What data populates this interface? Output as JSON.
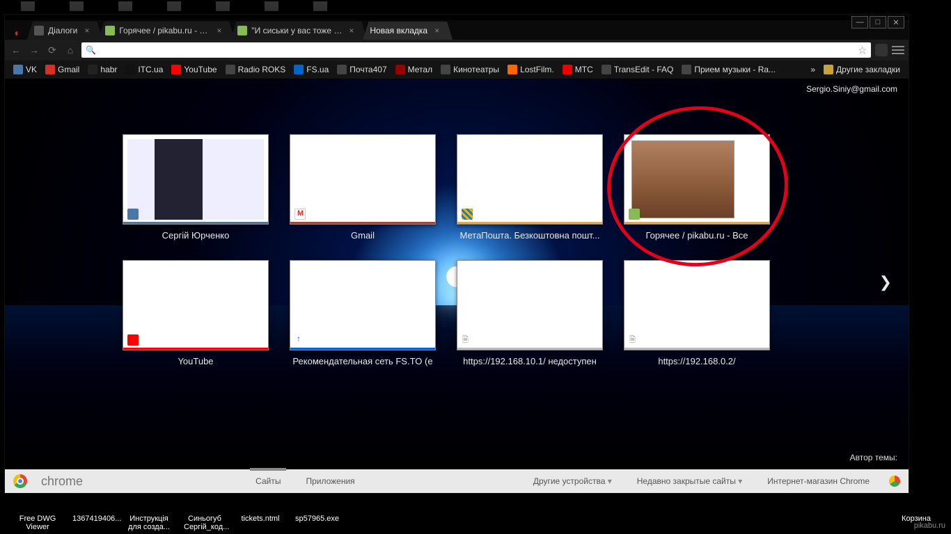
{
  "window_controls": {
    "min": "—",
    "max": "□",
    "close": "✕"
  },
  "tabs": [
    {
      "label": "Діалоги",
      "active": false
    },
    {
      "label": "Горячее / pikabu.ru - Все",
      "active": false
    },
    {
      "label": "\"И сиськи у вас тоже збс",
      "active": false
    },
    {
      "label": "Новая вкладка",
      "active": true
    }
  ],
  "omnibox": {
    "value": "",
    "placeholder": ""
  },
  "bookmarks": [
    {
      "label": "VK"
    },
    {
      "label": "Gmail"
    },
    {
      "label": "habr"
    },
    {
      "label": "ITC.ua"
    },
    {
      "label": "YouTube"
    },
    {
      "label": "Radio ROKS"
    },
    {
      "label": "FS.ua"
    },
    {
      "label": "Почта407"
    },
    {
      "label": "Метал"
    },
    {
      "label": "Кинотеатры"
    },
    {
      "label": "LostFilm."
    },
    {
      "label": "МТС"
    },
    {
      "label": "TransEdit - FAQ"
    },
    {
      "label": "Прием музыки - Ra..."
    }
  ],
  "bookmarks_overflow": "»",
  "other_bookmarks": "Другие закладки",
  "account": "Sergio.Siniy@gmail.com",
  "theme_author_label": "Автор темы:",
  "nav_arrow": "❯",
  "tiles": [
    {
      "title": "Сергій Юрченко",
      "style": "vk",
      "fav": "vk",
      "accent": "#4a76a8"
    },
    {
      "title": "Gmail",
      "style": "",
      "fav": "gmail",
      "accent": "#d93025"
    },
    {
      "title": "МетаПошта. Безкоштовна пошт...",
      "style": "",
      "fav": "meta",
      "accent": "#f5a623"
    },
    {
      "title": "Горячее / pikabu.ru - Все",
      "style": "pikabu",
      "fav": "pikabu",
      "accent": "#f5a623"
    },
    {
      "title": "YouTube",
      "style": "",
      "fav": "yt",
      "accent": "#f00"
    },
    {
      "title": "Рекомендательная сеть FS.TO (e",
      "style": "",
      "fav": "fs",
      "accent": "#06c"
    },
    {
      "title": "https://192.168.10.1/ недоступен",
      "style": "",
      "fav": "doc",
      "accent": "#bbb"
    },
    {
      "title": "https://192.168.0.2/",
      "style": "",
      "fav": "doc",
      "accent": "#bbb"
    }
  ],
  "footer": {
    "brand": "chrome",
    "sites": "Сайты",
    "apps": "Приложения",
    "devices": "Другие устройства",
    "recent": "Недавно закрытые сайты",
    "store": "Интернет-магазин Chrome"
  },
  "desktop_labels": [
    "Free DWG Viewer",
    "1367419406...",
    "Инструкція для созда...",
    "Синьогуб Сергій_код...",
    "tickets.ntml",
    "sp57965.exe",
    "Корзина"
  ],
  "watermark": "pikabu.ru"
}
